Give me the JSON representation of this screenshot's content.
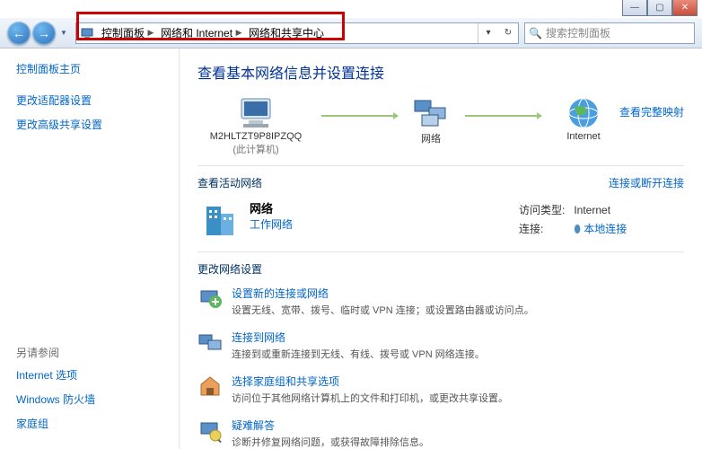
{
  "window_buttons": {
    "minimize": "—",
    "maximize": "▢",
    "close": "✕"
  },
  "breadcrumb": {
    "items": [
      "控制面板",
      "网络和 Internet",
      "网络和共享中心"
    ]
  },
  "search": {
    "placeholder": "搜索控制面板"
  },
  "sidebar": {
    "home": "控制面板主页",
    "links": [
      "更改适配器设置",
      "更改高级共享设置"
    ],
    "see_also_heading": "另请参阅",
    "see_also": [
      "Internet 选项",
      "Windows 防火墙",
      "家庭组"
    ]
  },
  "main": {
    "title": "查看基本网络信息并设置连接",
    "diagram": {
      "computer": {
        "name": "M2HLTZT9P8IPZQQ",
        "sub": "(此计算机)"
      },
      "network": {
        "name": "网络"
      },
      "internet": {
        "name": "Internet"
      },
      "full_map": "查看完整映射"
    },
    "active": {
      "heading": "查看活动网络",
      "action": "连接或断开连接",
      "network_name": "网络",
      "network_type": "工作网络",
      "access_label": "访问类型:",
      "access_value": "Internet",
      "conn_label": "连接:",
      "conn_value": "本地连接"
    },
    "settings": {
      "heading": "更改网络设置",
      "items": [
        {
          "title": "设置新的连接或网络",
          "desc": "设置无线、宽带、拨号、临时或 VPN 连接；或设置路由器或访问点。"
        },
        {
          "title": "连接到网络",
          "desc": "连接到或重新连接到无线、有线、拨号或 VPN 网络连接。"
        },
        {
          "title": "选择家庭组和共享选项",
          "desc": "访问位于其他网络计算机上的文件和打印机，或更改共享设置。"
        },
        {
          "title": "疑难解答",
          "desc": "诊断并修复网络问题，或获得故障排除信息。"
        }
      ]
    }
  }
}
